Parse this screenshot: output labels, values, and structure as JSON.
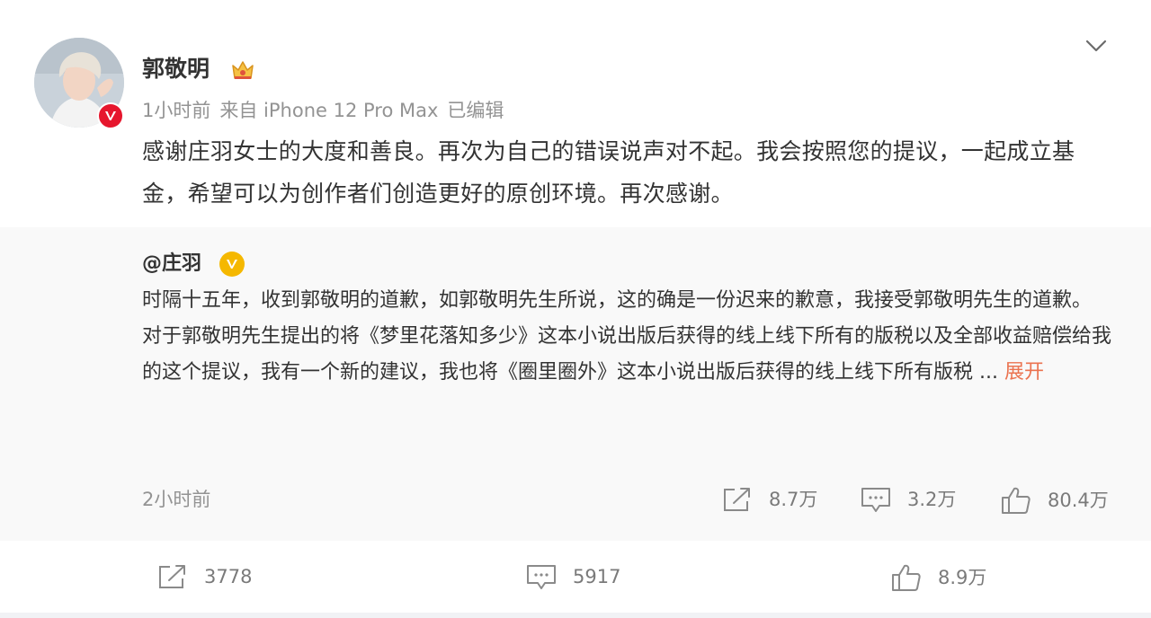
{
  "post": {
    "author": "郭敬明",
    "meta": {
      "time": "1小时前",
      "source": "来自 iPhone 12 Pro Max",
      "edited": "已编辑"
    },
    "text": "感谢庄羽女士的大度和善良。再次为自己的错误说声对不起。我会按照您的提议，一起成立基金，希望可以为创作者们创造更好的原创环境。再次感谢。"
  },
  "repost": {
    "author": "@庄羽",
    "paragraph1": "时隔十五年，收到郭敬明的道歉，如郭敬明先生所说，这的确是一份迟来的歉意，我接受郭敬明先生的道歉。",
    "paragraph2": "对于郭敬明先生提出的将《梦里花落知多少》这本小说出版后获得的线上线下所有的版税以及全部收益赔偿给我的这个提议，我有一个新的建议，我也将《圈里圈外》这本小说出版后获得的线上线下所有版税",
    "ellipsis": "...",
    "expand_label": "展开",
    "time": "2小时前",
    "actions": {
      "share": "8.7万",
      "comment": "3.2万",
      "like": "80.4万"
    }
  },
  "footer_actions": {
    "share": "3778",
    "comment": "5917",
    "like": "8.9万"
  },
  "colors": {
    "accent_link": "#eb7350",
    "verified_red": "#e6162d",
    "verified_gold": "#f5b800",
    "muted_text": "#939393",
    "repost_bg": "#f9f9f9",
    "page_bg": "#f1f2f5"
  },
  "icons": [
    "crown-icon",
    "chevron-down-icon",
    "share-icon",
    "comment-icon",
    "like-icon",
    "verified-icon"
  ]
}
